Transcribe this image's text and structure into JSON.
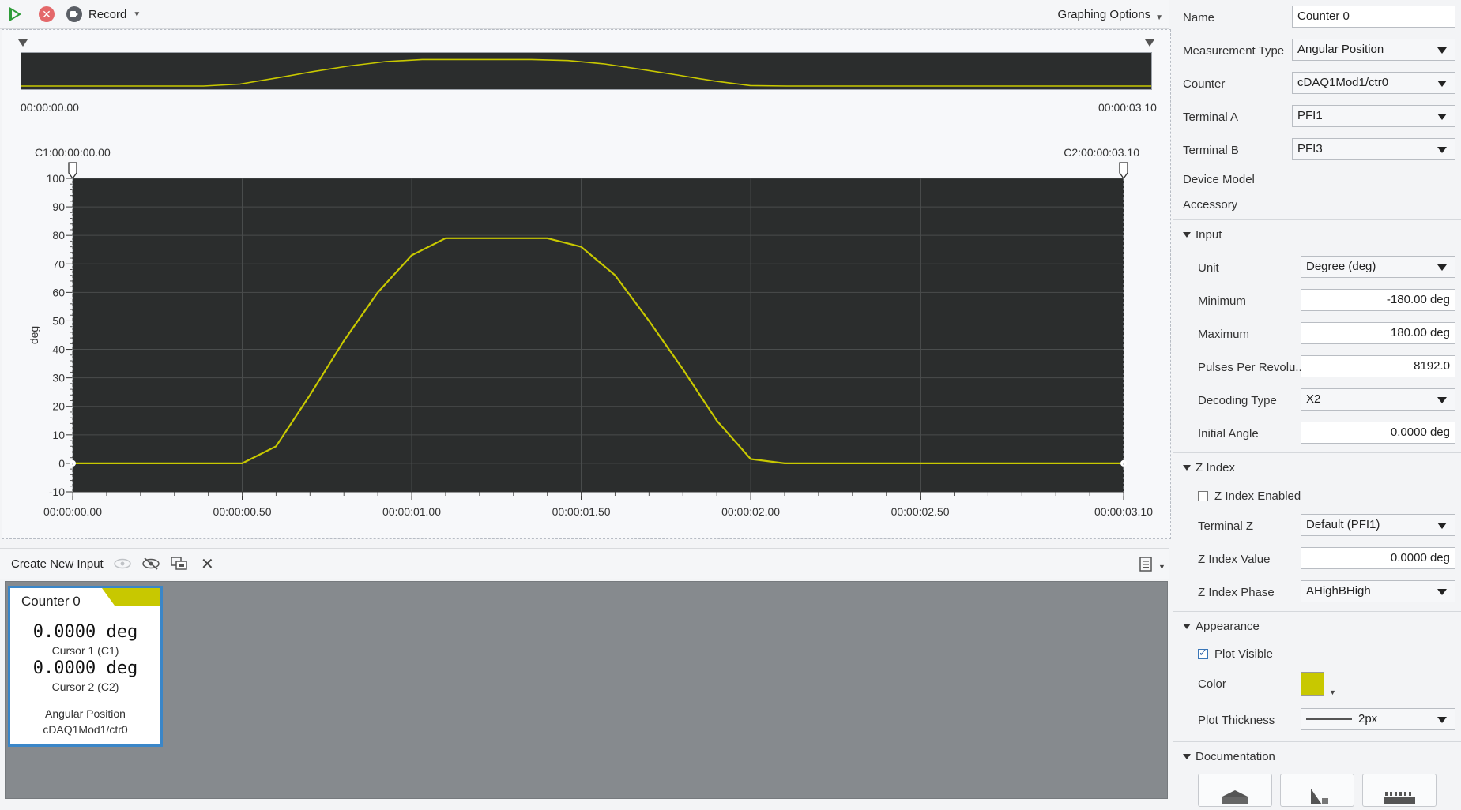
{
  "toolbar": {
    "record_label": "Record",
    "graphing_options_label": "Graphing Options"
  },
  "overview": {
    "start_time": "00:00:00.00",
    "end_time": "00:00:03.10"
  },
  "chart_data": {
    "type": "line",
    "ylabel": "deg",
    "ylim": [
      -10,
      100
    ],
    "yticks": [
      100,
      90,
      80,
      70,
      60,
      50,
      40,
      30,
      20,
      10,
      0,
      -10
    ],
    "xlim": [
      0,
      3.1
    ],
    "xticks": [
      {
        "t": 0,
        "label": "00:00:00.00"
      },
      {
        "t": 0.5,
        "label": "00:00:00.50"
      },
      {
        "t": 1.0,
        "label": "00:00:01.00"
      },
      {
        "t": 1.5,
        "label": "00:00:01.50"
      },
      {
        "t": 2.0,
        "label": "00:00:02.00"
      },
      {
        "t": 2.5,
        "label": "00:00:02.50"
      },
      {
        "t": 3.1,
        "label": "00:00:03.10"
      }
    ],
    "cursors": [
      {
        "label": "C1:00:00:00.00",
        "t": 0
      },
      {
        "label": "C2:00:00:03.10",
        "t": 3.1
      }
    ],
    "series": [
      {
        "color": "#c8c800",
        "x": [
          0,
          0.5,
          0.6,
          0.7,
          0.8,
          0.9,
          1.0,
          1.1,
          1.2,
          1.3,
          1.4,
          1.5,
          1.6,
          1.7,
          1.8,
          1.9,
          2.0,
          2.1,
          2.5,
          3.1
        ],
        "y": [
          0,
          0,
          6,
          24,
          43,
          60,
          73,
          79,
          79,
          79,
          79,
          76,
          66,
          50,
          33,
          15,
          1.5,
          0,
          0,
          0
        ]
      }
    ],
    "grid": true,
    "background": "#2b2d2d"
  },
  "inputs_bar": {
    "create_label": "Create New Input"
  },
  "card": {
    "title": "Counter 0",
    "accent": "#c8c800",
    "c1_value": "0.0000 deg",
    "c1_label": "Cursor 1 (C1)",
    "c2_value": "0.0000 deg",
    "c2_label": "Cursor 2 (C2)",
    "type": "Angular Position",
    "channel": "cDAQ1Mod1/ctr0"
  },
  "props": {
    "name_label": "Name",
    "name_value": "Counter 0",
    "mtype_label": "Measurement Type",
    "mtype_value": "Angular Position",
    "counter_label": "Counter",
    "counter_value": "cDAQ1Mod1/ctr0",
    "terma_label": "Terminal A",
    "terma_value": "PFI1",
    "termb_label": "Terminal B",
    "termb_value": "PFI3",
    "device_model_label": "Device Model",
    "accessory_label": "Accessory",
    "input_section": "Input",
    "unit_label": "Unit",
    "unit_value": "Degree (deg)",
    "min_label": "Minimum",
    "min_value": "-180.00 deg",
    "max_label": "Maximum",
    "max_value": "180.00 deg",
    "ppr_label": "Pulses Per Revolu...",
    "ppr_value": "8192.0",
    "decoding_label": "Decoding Type",
    "decoding_value": "X2",
    "initial_label": "Initial Angle",
    "initial_value": "0.0000 deg",
    "zindex_section": "Z Index",
    "zindex_enabled_label": "Z Index Enabled",
    "termz_label": "Terminal Z",
    "termz_value": "Default (PFI1)",
    "zvalue_label": "Z Index Value",
    "zvalue_value": "0.0000 deg",
    "zphase_label": "Z Index Phase",
    "zphase_value": "AHighBHigh",
    "appearance_section": "Appearance",
    "plot_visible_label": "Plot Visible",
    "color_label": "Color",
    "color_value": "#c8c800",
    "thickness_label": "Plot Thickness",
    "thickness_value": "2px",
    "documentation_section": "Documentation"
  }
}
